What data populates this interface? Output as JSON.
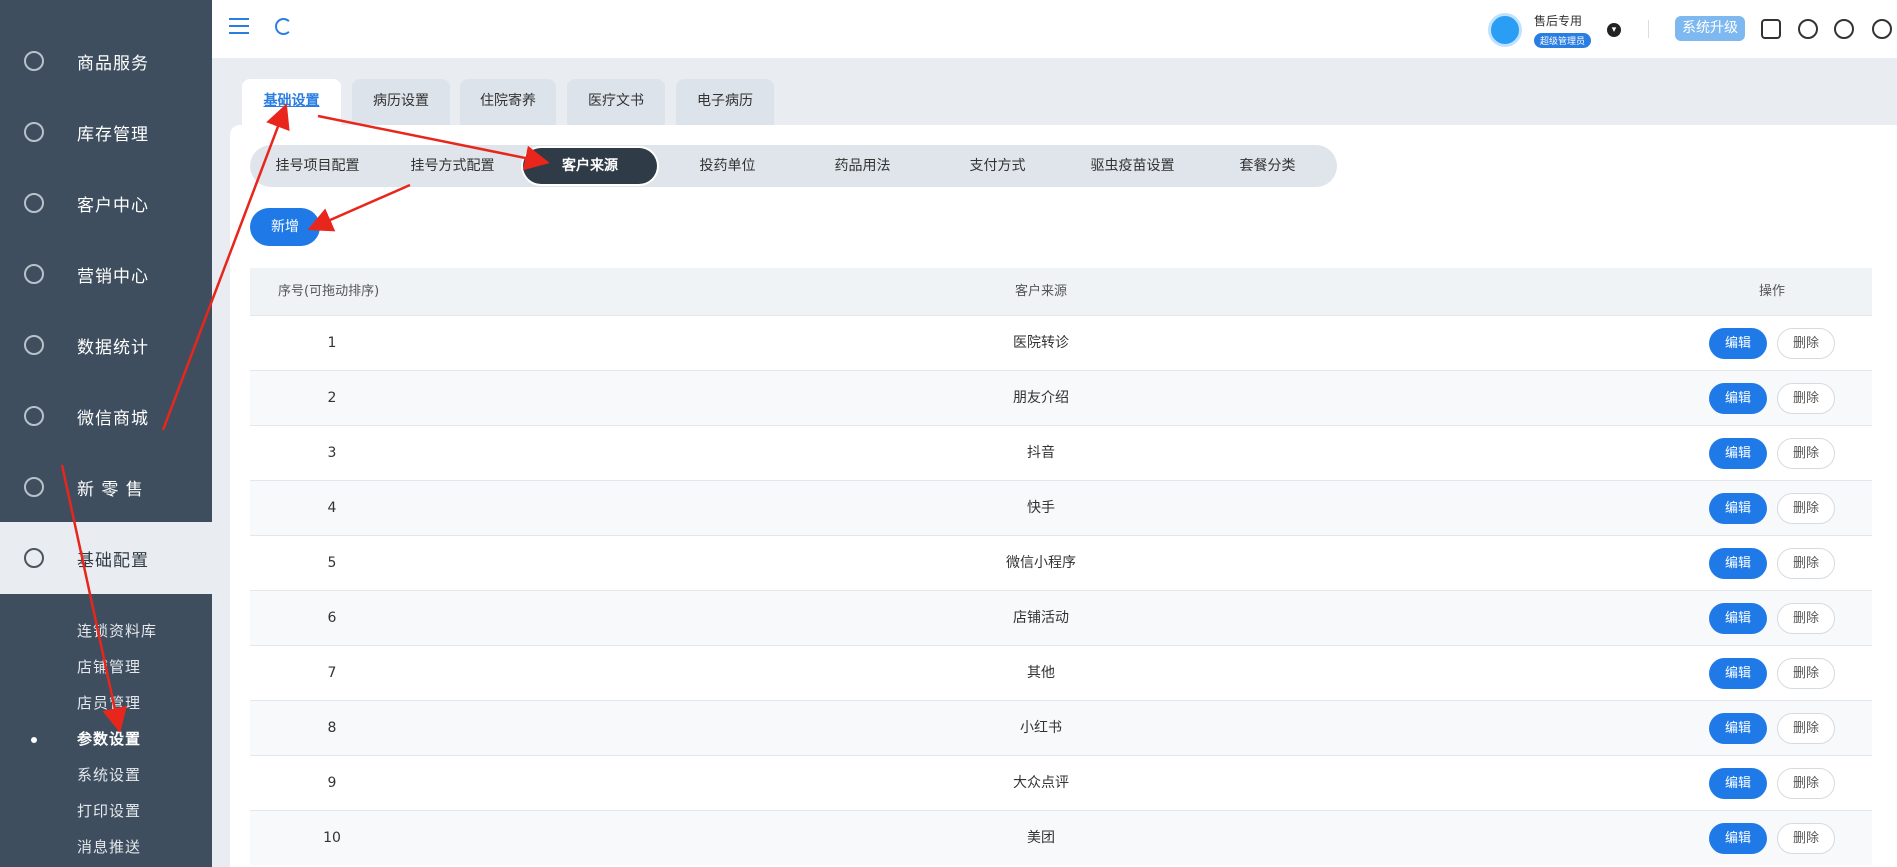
{
  "sidebar": {
    "items": [
      {
        "label": "商品服务",
        "icon": "goods-icon"
      },
      {
        "label": "库存管理",
        "icon": "inventory-icon"
      },
      {
        "label": "客户中心",
        "icon": "customer-icon"
      },
      {
        "label": "营销中心",
        "icon": "marketing-icon"
      },
      {
        "label": "数据统计",
        "icon": "stats-icon"
      },
      {
        "label": "微信商城",
        "icon": "wechat-icon"
      },
      {
        "label": "新 零 售",
        "icon": "retail-icon"
      },
      {
        "label": "基础配置",
        "icon": "settings-icon"
      }
    ],
    "sub_items": [
      "连锁资料库",
      "店铺管理",
      "店员管理",
      "参数设置",
      "系统设置",
      "打印设置",
      "消息推送"
    ],
    "active_sub": "参数设置"
  },
  "header": {
    "user_name": "售后专用",
    "user_role": "超级管理员",
    "upgrade_label": "系统升级"
  },
  "top_tabs": [
    "基础设置",
    "病历设置",
    "住院寄养",
    "医疗文书",
    "电子病历"
  ],
  "sub_tabs": [
    "挂号项目配置",
    "挂号方式配置",
    "客户来源",
    "投药单位",
    "药品用法",
    "支付方式",
    "驱虫疫苗设置",
    "套餐分类"
  ],
  "add_label": "新增",
  "table": {
    "headers": {
      "index": "序号(可拖动排序)",
      "source": "客户来源",
      "action": "操作"
    },
    "edit_label": "编辑",
    "delete_label": "删除",
    "rows": [
      {
        "index": "1",
        "source": "医院转诊"
      },
      {
        "index": "2",
        "source": "朋友介绍"
      },
      {
        "index": "3",
        "source": "抖音"
      },
      {
        "index": "4",
        "source": "快手"
      },
      {
        "index": "5",
        "source": "微信小程序"
      },
      {
        "index": "6",
        "source": "店铺活动"
      },
      {
        "index": "7",
        "source": "其他"
      },
      {
        "index": "8",
        "source": "小红书"
      },
      {
        "index": "9",
        "source": "大众点评"
      },
      {
        "index": "10",
        "source": "美团"
      }
    ]
  },
  "colors": {
    "accent": "#1f7ae8",
    "sidebar": "#3e4e5e",
    "annotation": "#e8261c"
  }
}
